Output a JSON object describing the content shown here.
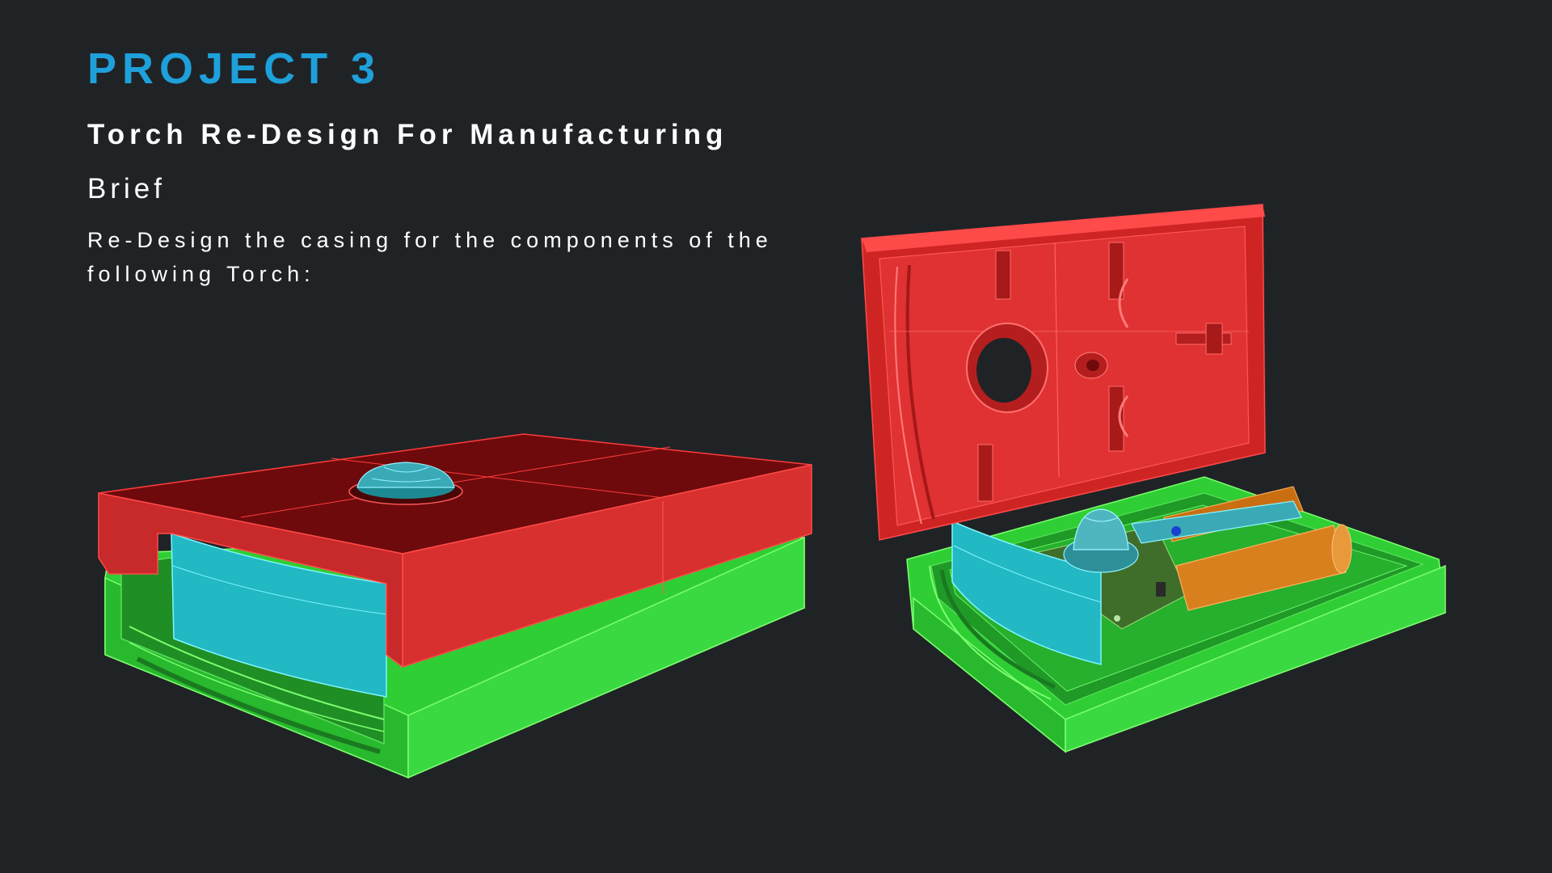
{
  "slide": {
    "project_label": "PROJECT 3",
    "subtitle": "Torch Re-Design For Manufacturing",
    "brief_heading": "Brief",
    "brief_text": "Re-Design the casing for the components of the following Torch:"
  },
  "colors": {
    "background": "#202326",
    "accent": "#1ea0db",
    "casing_top": "#e02a2a",
    "casing_bottom": "#33d33a",
    "reflector": "#22b8c4",
    "battery": "#d9801e",
    "pcb": "#3f6e2a"
  },
  "illustrations": {
    "closed": "closed-torch-casing-render",
    "open": "open-torch-casing-render"
  }
}
